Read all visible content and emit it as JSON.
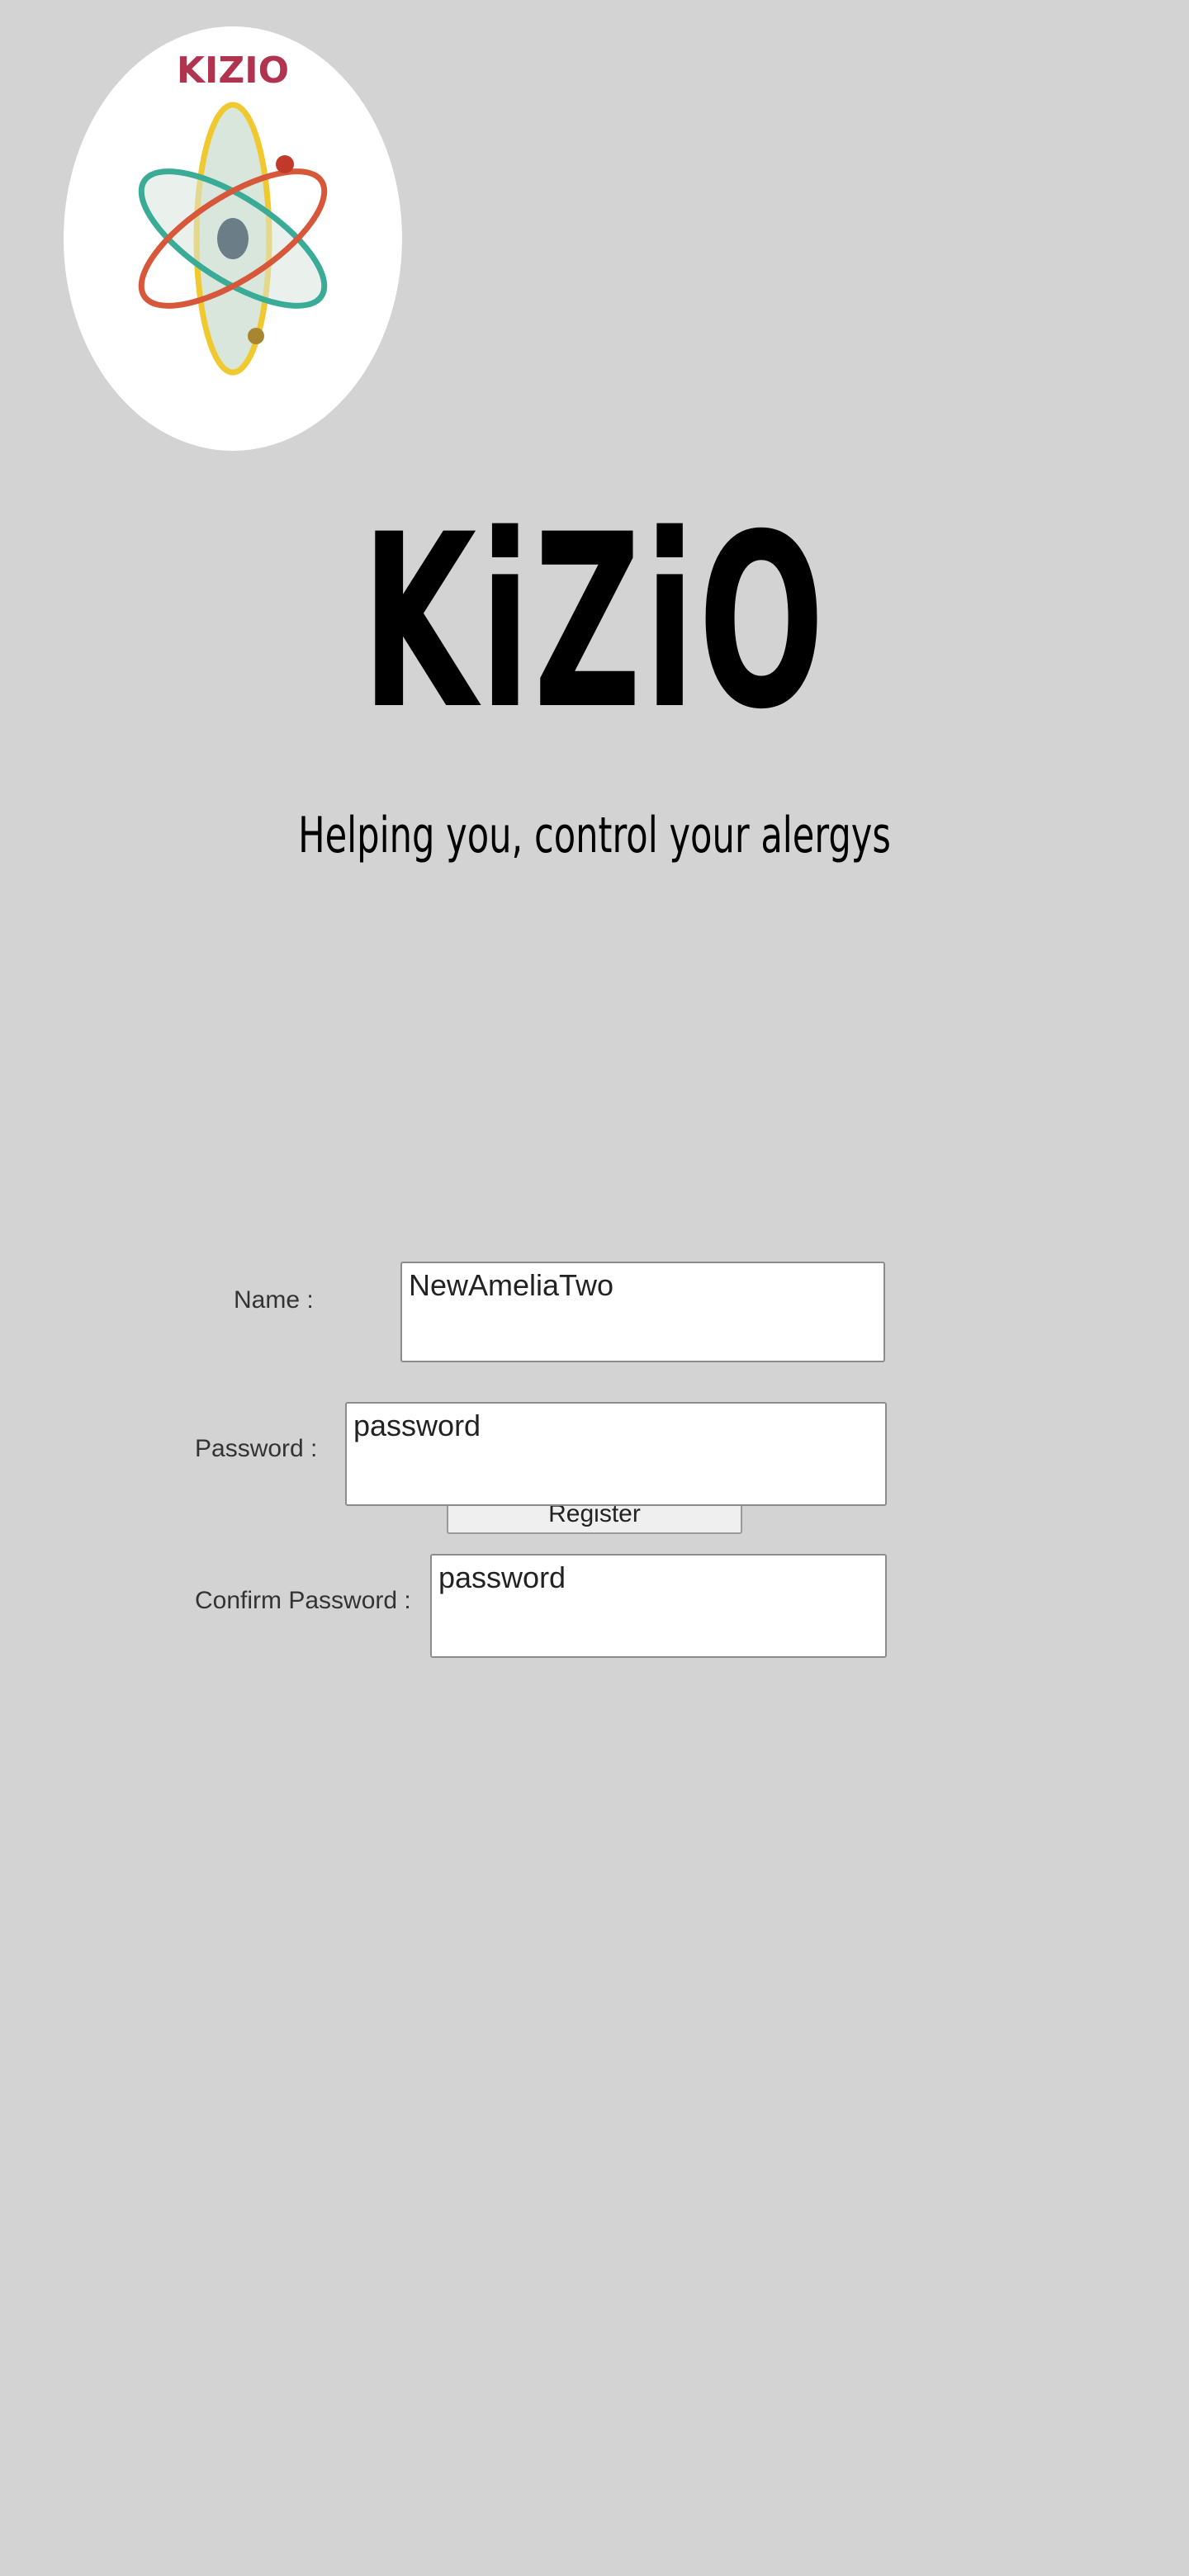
{
  "logo": {
    "text": "KIZIO",
    "colors": {
      "background": "#ffffff",
      "text": "#b0334f",
      "orbit_yellow": "#f0c830",
      "orbit_teal": "#3aab96",
      "orbit_red": "#d6573a",
      "nucleus": "#6b7d87",
      "orbit_fill": "#d9e6dc"
    }
  },
  "brand": {
    "title": "KiZiO",
    "tagline": "Helping you, control your alergys"
  },
  "form": {
    "name": {
      "label": "Name :",
      "value": "NewAmeliaTwo"
    },
    "password": {
      "label": "Password :",
      "value": "password"
    },
    "confirm_password": {
      "label": "Confirm Password :",
      "value": "password"
    },
    "obscured_button": {
      "label": "Register"
    }
  },
  "colors": {
    "page_background": "#d3d3d3",
    "field_border": "#8c8c8c",
    "label_text": "#333333"
  }
}
